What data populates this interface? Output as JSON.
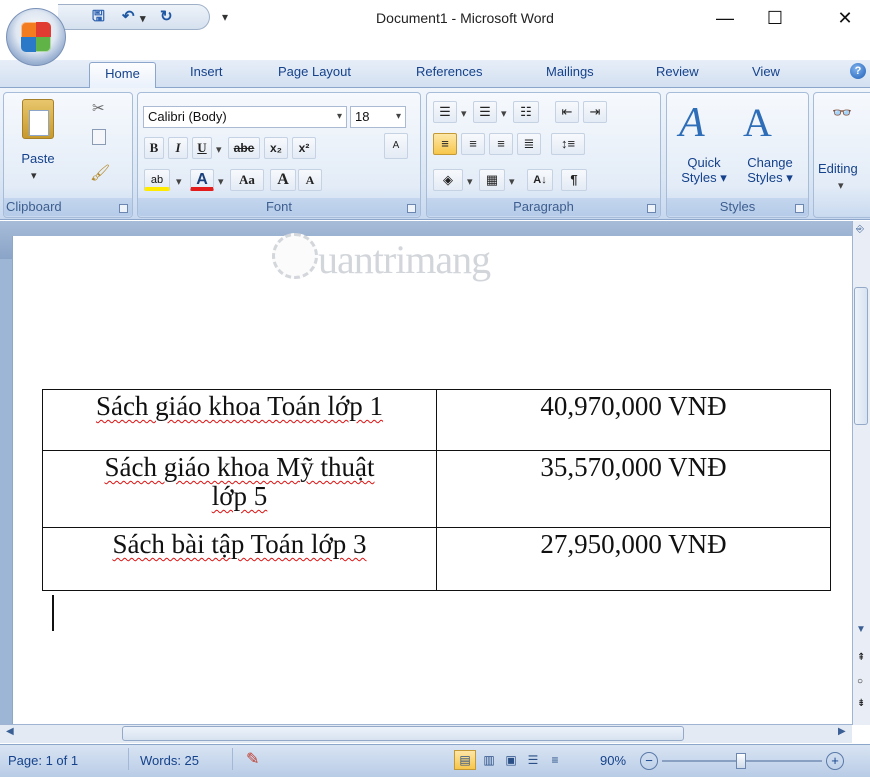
{
  "window": {
    "title": "Document1 - Microsoft Word",
    "minimize": "—",
    "maximize": "☐",
    "close": "✕"
  },
  "qat": {
    "save": "🖫",
    "undo": "↶",
    "undo_drop": "▾",
    "redo": "↻",
    "customize": "₹"
  },
  "tabs": [
    "Home",
    "Insert",
    "Page Layout",
    "References",
    "Mailings",
    "Review",
    "View"
  ],
  "clipboard": {
    "label": "Clipboard",
    "paste": "Paste"
  },
  "font": {
    "label": "Font",
    "name": "Calibri (Body)",
    "size": "18",
    "bold": "B",
    "italic": "I",
    "underline": "U",
    "strike": "abe",
    "sub": "x₂",
    "sup": "x²",
    "case": "Aa",
    "grow": "A",
    "shrink": "A",
    "font_color": "A",
    "highlight": "ab"
  },
  "paragraph": {
    "label": "Paragraph",
    "sort": "A↓",
    "pilcrow": "¶"
  },
  "styles": {
    "label": "Styles",
    "quick": "Quick",
    "quick2": "Styles",
    "change": "Change",
    "change2": "Styles"
  },
  "editing": {
    "label": "Editing"
  },
  "watermark": "uantrimang",
  "table": [
    {
      "item_lines": [
        "Sách giáo khoa Toán lớp 1"
      ],
      "price": "40,970,000 VNĐ"
    },
    {
      "item_lines": [
        "Sách giáo khoa Mỹ thuật",
        "lớp 5"
      ],
      "price": "35,570,000 VNĐ"
    },
    {
      "item_lines": [
        "Sách bài tập Toán lớp 3"
      ],
      "price": "27,950,000 VNĐ"
    }
  ],
  "status": {
    "page": "Page: 1 of 1",
    "words": "Words: 25",
    "zoom": "90%"
  },
  "colors": {
    "accent": "#15428b",
    "ribbon": "#dbe6f4",
    "spell": "#d11"
  }
}
